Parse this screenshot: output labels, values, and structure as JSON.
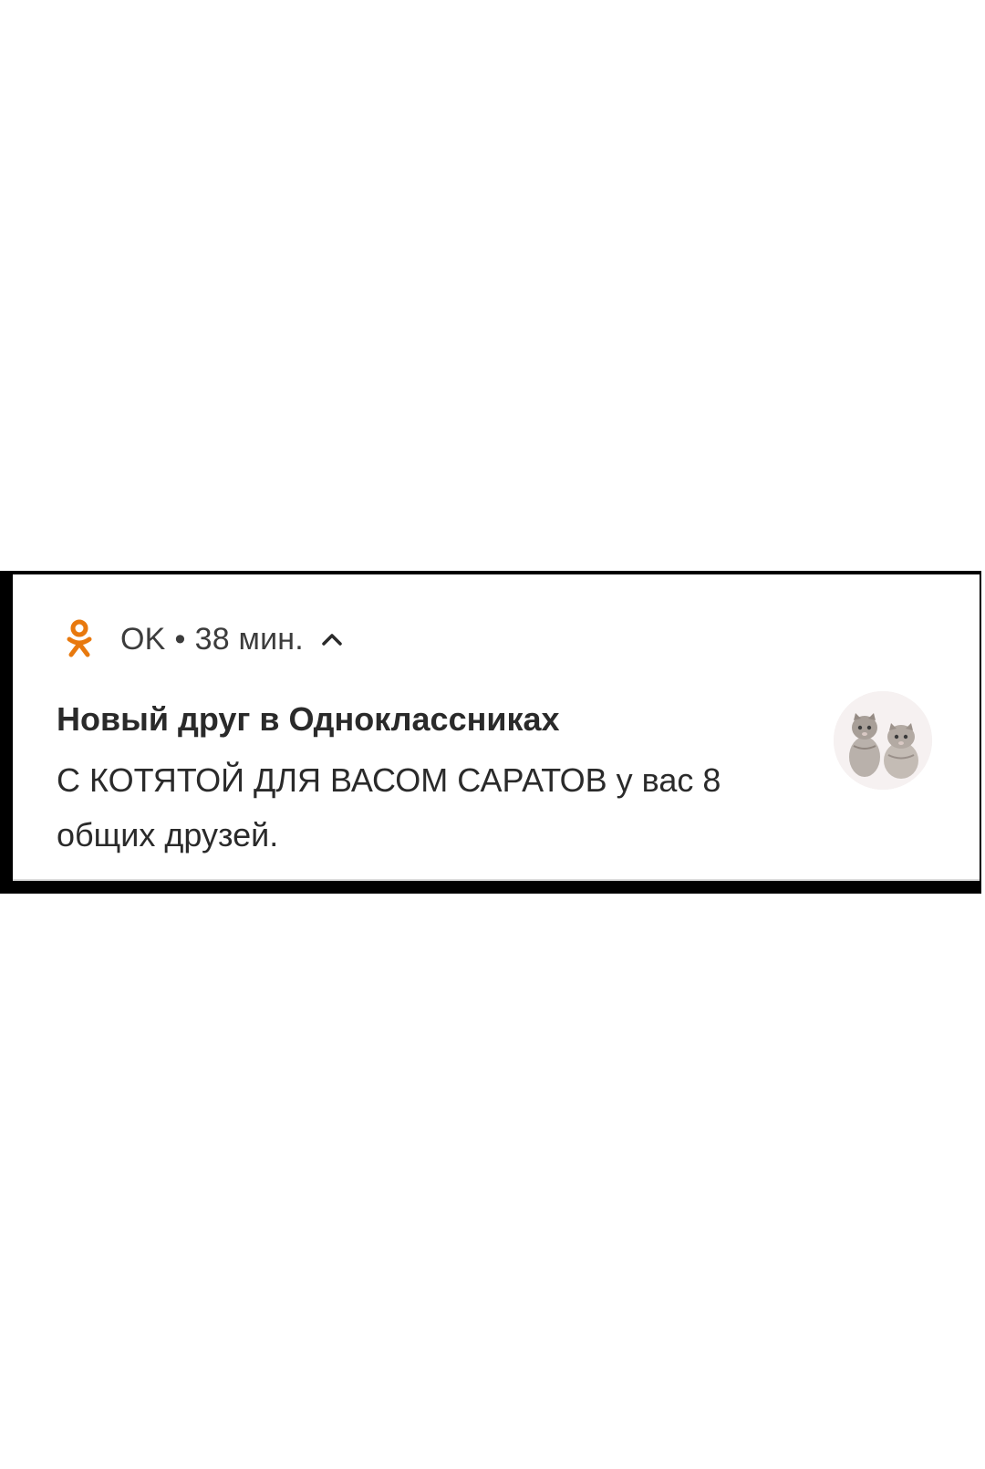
{
  "notification": {
    "app_name": "OK",
    "separator": "•",
    "time": "38 мин.",
    "title": "Новый друг в Одноклассниках",
    "body": "С КОТЯТОЙ ДЛЯ ВАСОМ САРАТОВ у вас 8 общих друзей.",
    "app_icon": "odnoklassniki-logo-icon",
    "expand_icon": "chevron-up-icon",
    "avatar_icon": "kittens-avatar-image"
  },
  "colors": {
    "app_accent": "#e8790e",
    "frame": "#000000",
    "card": "#ffffff"
  }
}
